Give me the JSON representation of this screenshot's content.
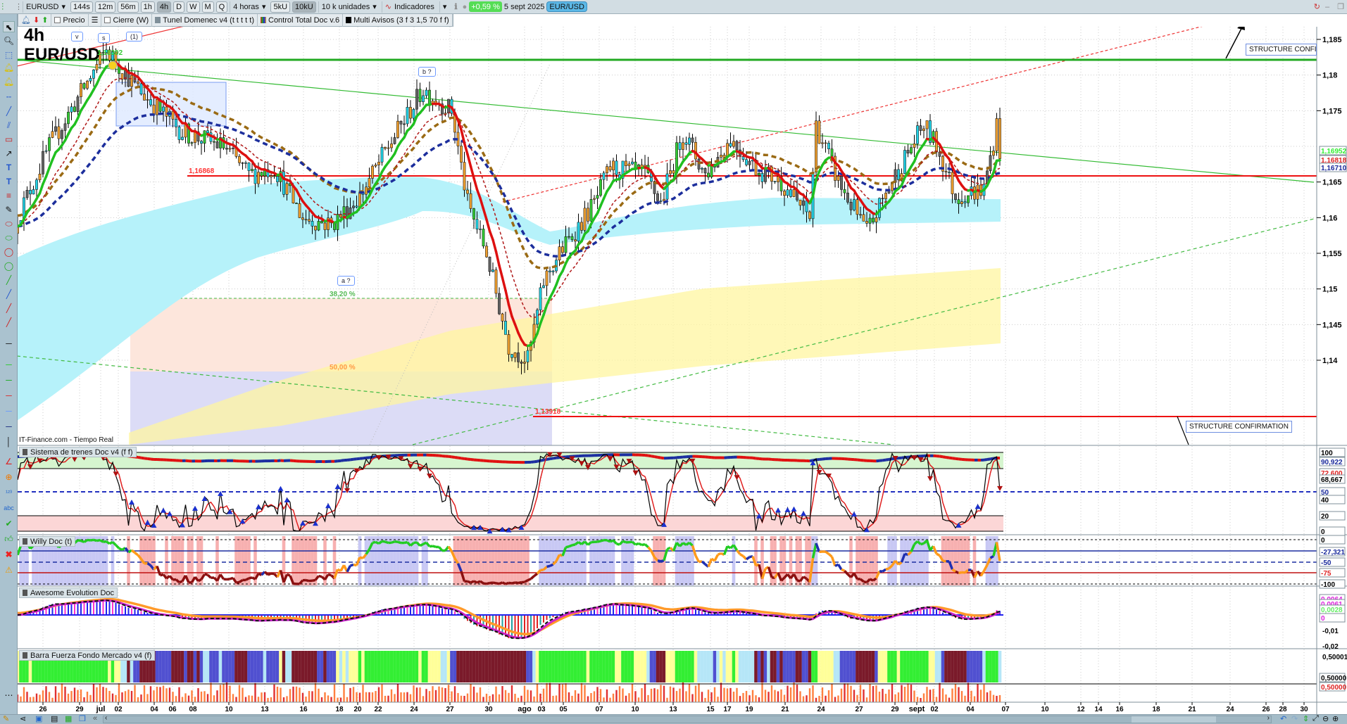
{
  "toolbar": {
    "symbol": "EURUSD",
    "timeframes": [
      "144s",
      "12m",
      "56m",
      "1h",
      "4h",
      "D",
      "W",
      "M",
      "Q"
    ],
    "period": "4 horas",
    "units": [
      "5kU",
      "10kU"
    ],
    "units_select": "10 k unidades",
    "indicators": "Indicadores",
    "change": "+0,59 %",
    "date": "5 sept 2025",
    "pair": "EUR/USD"
  },
  "legend_bar": {
    "items": [
      "Precio",
      "Cierre (W)",
      "Tunel Domenec v4 (t t t t t)",
      "Control Total Doc v.6",
      "Multi Avisos (3 f 3 1,5 70 f f)"
    ]
  },
  "chart": {
    "timeframe_label": "4h",
    "symbol_label": "EUR/USD",
    "wave_v": "v",
    "wave_s": "s",
    "wave_1": "(1)",
    "wave_b": "b ?",
    "wave_a": "a ?",
    "level_high": "1,18302",
    "level_mid": "1,16868",
    "level_low": "1,13918",
    "fib_382": "38,20 %",
    "fib_50": "50,00 %",
    "structure_top": "STRUCTURE CONFIR",
    "structure_bottom": "STRUCTURE CONFIRMATION",
    "source": "IT-Finance.com - Tiempo Real",
    "price_ticks": [
      "1,185",
      "1,18",
      "1,175",
      "1,17",
      "1,165",
      "1,16",
      "1,155",
      "1,15",
      "1,145",
      "1,14"
    ],
    "price_tags": [
      {
        "text": "1,16952",
        "color": "#33ee33"
      },
      {
        "text": "1,16818",
        "color": "#dd2222"
      },
      {
        "text": "1,16710",
        "color": "#1a2a9c"
      }
    ]
  },
  "panels": {
    "trenes": {
      "title": "Sistema de trenes Doc v4 (f f)",
      "ticks": [
        "100",
        "90,922",
        "72,600",
        "68,667",
        "50",
        "40",
        "20",
        "0"
      ]
    },
    "willy": {
      "title": "Willy Doc (t)",
      "ticks": [
        "0",
        "-27,321",
        "-50",
        "-75",
        "-100"
      ]
    },
    "awesome": {
      "title": "Awesome Evolution Doc",
      "ticks": [
        "0,0064",
        "0,0061",
        "0,0028",
        "0",
        "-0,01",
        "-0,02"
      ]
    },
    "barra": {
      "title": "Barra Fuerza Fondo Mercado v4 (f)",
      "ticks": [
        "0,50001",
        "0,50000",
        "0,50000"
      ]
    }
  },
  "date_axis": [
    "26",
    "29",
    "jul",
    "02",
    "04",
    "06",
    "08",
    "10",
    "13",
    "16",
    "18",
    "20",
    "22",
    "24",
    "27",
    "30",
    "ago",
    "03",
    "05",
    "07",
    "10",
    "13",
    "15",
    "17",
    "19",
    "21",
    "24",
    "27",
    "29",
    "sept",
    "02",
    "04",
    "07",
    "10",
    "12",
    "14",
    "16",
    "18",
    "21",
    "24",
    "26",
    "28",
    "30"
  ],
  "chart_data": {
    "type": "line",
    "title": "EUR/USD 4h",
    "ylim": [
      1.137,
      1.188
    ],
    "anchors_bar_close": [
      [
        0,
        1.16
      ],
      [
        10,
        1.17
      ],
      [
        28,
        1.1835
      ],
      [
        38,
        1.178
      ],
      [
        52,
        1.172
      ],
      [
        65,
        1.17
      ],
      [
        73,
        1.166
      ],
      [
        81,
        1.167
      ],
      [
        90,
        1.16
      ],
      [
        99,
        1.159
      ],
      [
        108,
        1.163
      ],
      [
        117,
        1.17
      ],
      [
        128,
        1.178
      ],
      [
        137,
        1.175
      ],
      [
        142,
        1.162
      ],
      [
        148,
        1.155
      ],
      [
        155,
        1.142
      ],
      [
        161,
        1.14
      ],
      [
        166,
        1.151
      ],
      [
        171,
        1.155
      ],
      [
        182,
        1.162
      ],
      [
        187,
        1.167
      ],
      [
        198,
        1.166
      ],
      [
        203,
        1.162
      ],
      [
        210,
        1.172
      ],
      [
        217,
        1.166
      ],
      [
        225,
        1.171
      ],
      [
        233,
        1.167
      ],
      [
        241,
        1.165
      ],
      [
        250,
        1.16
      ],
      [
        252,
        1.173
      ],
      [
        259,
        1.165
      ],
      [
        268,
        1.158
      ],
      [
        277,
        1.166
      ],
      [
        286,
        1.173
      ],
      [
        290,
        1.17
      ],
      [
        296,
        1.163
      ],
      [
        305,
        1.164
      ],
      [
        309,
        1.173
      ],
      [
        310,
        1.1695
      ]
    ]
  }
}
